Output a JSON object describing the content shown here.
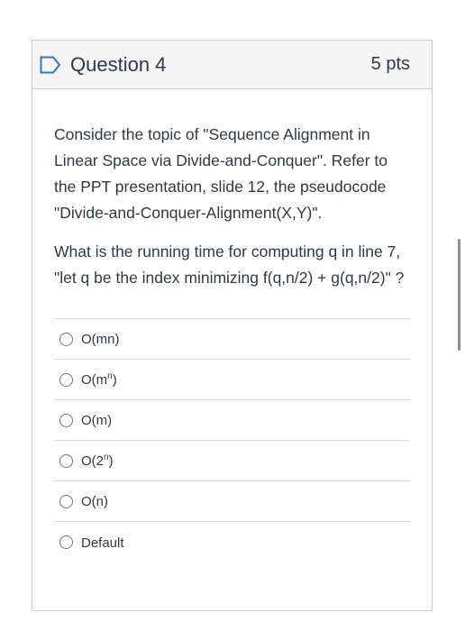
{
  "question": {
    "title": "Question 4",
    "points": "5 pts",
    "paragraphs": [
      "Consider the topic of \"Sequence Alignment in Linear Space via Divide-and-Conquer\".  Refer to the PPT presentation, slide 12, the pseudocode \"Divide-and-Conquer-Alignment(X,Y)\".",
      "What is the running time for computing q in line 7, \"let q be the index minimizing f(q,n/2) + g(q,n/2)\" ?"
    ]
  },
  "answers": [
    {
      "base": "O(mn)",
      "sup": "",
      "tail": ""
    },
    {
      "base": "O(m",
      "sup": "n",
      "tail": ")"
    },
    {
      "base": "O(m)",
      "sup": "",
      "tail": ""
    },
    {
      "base": "O(2",
      "sup": "n",
      "tail": ")"
    },
    {
      "base": "O(n)",
      "sup": "",
      "tail": ""
    },
    {
      "base": "Default",
      "sup": "",
      "tail": ""
    }
  ],
  "colors": {
    "flag": "#2d7bc8",
    "header_bg": "#f5f5f5",
    "border": "#c7cdd1",
    "text": "#2d3b45"
  },
  "icons": {
    "flag": "bookmark-flag-icon",
    "radio": "radio-unchecked-icon"
  }
}
